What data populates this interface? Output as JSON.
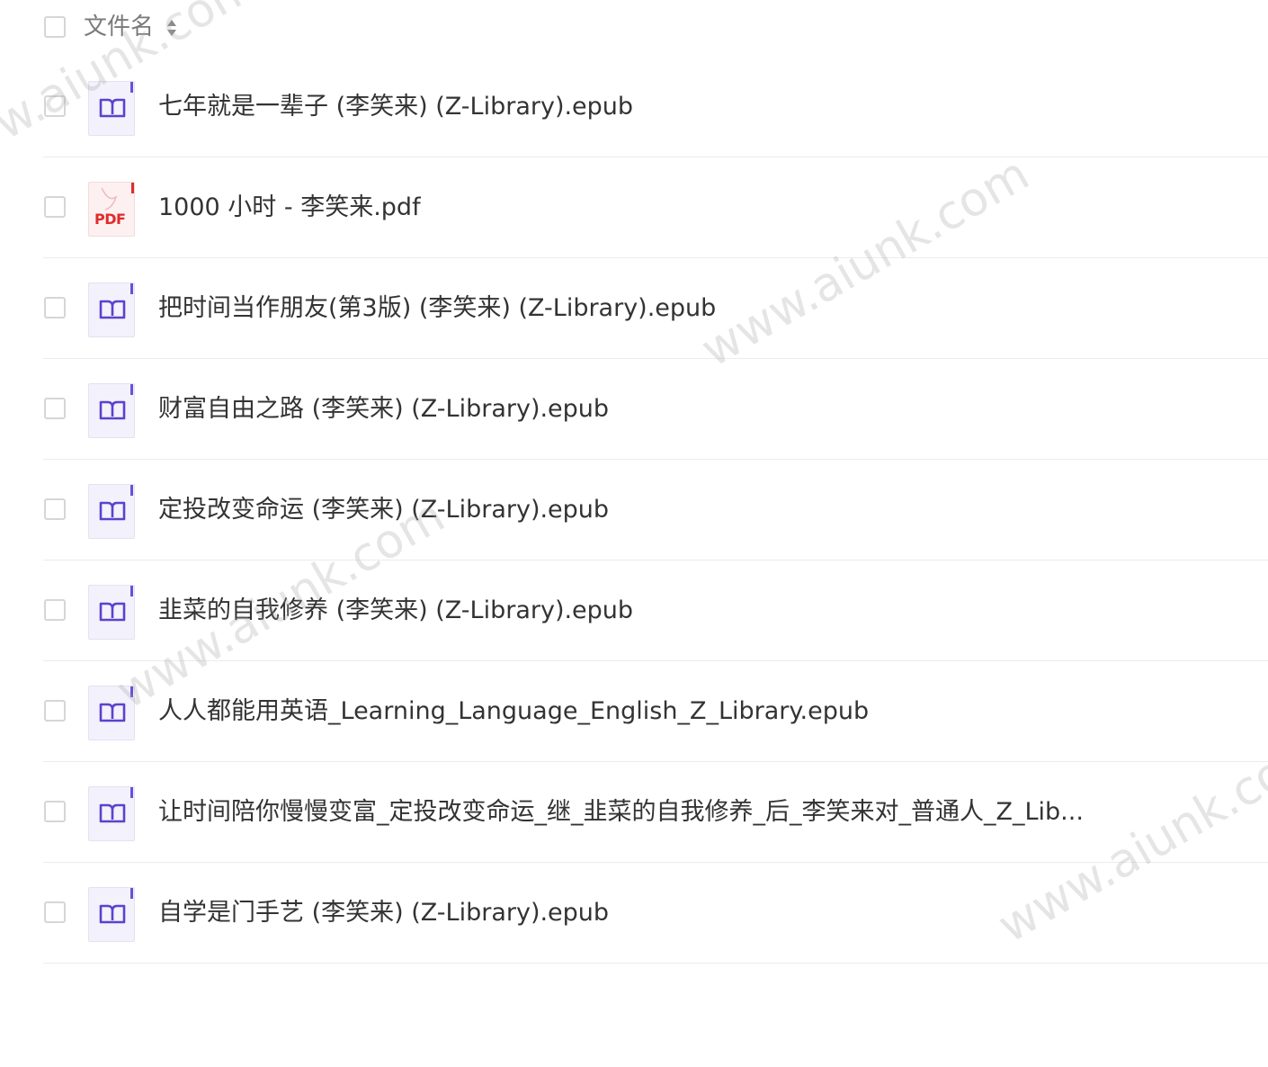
{
  "header": {
    "column_label": "文件名"
  },
  "files": [
    {
      "name": "七年就是一辈子 (李笑来) (Z-Library).epub",
      "type": "epub"
    },
    {
      "name": "1000 小时 - 李笑来.pdf",
      "type": "pdf"
    },
    {
      "name": "把时间当作朋友(第3版) (李笑来) (Z-Library).epub",
      "type": "epub"
    },
    {
      "name": "财富自由之路 (李笑来) (Z-Library).epub",
      "type": "epub"
    },
    {
      "name": "定投改变命运 (李笑来) (Z-Library).epub",
      "type": "epub"
    },
    {
      "name": "韭菜的自我修养 (李笑来) (Z-Library).epub",
      "type": "epub"
    },
    {
      "name": "人人都能用英语_Learning_Language_English_Z_Library.epub",
      "type": "epub"
    },
    {
      "name": "让时间陪你慢慢变富_定投改变命运_继_韭菜的自我修养_后_李笑来对_普通人_Z_Lib...",
      "type": "epub"
    },
    {
      "name": "自学是门手艺 (李笑来) (Z-Library).epub",
      "type": "epub"
    }
  ],
  "icons": {
    "epub": "book-icon",
    "pdf": "pdf-icon",
    "sort": "sort-icon"
  },
  "pdf_badge": "PDF",
  "watermark": "www.aiunk.com"
}
